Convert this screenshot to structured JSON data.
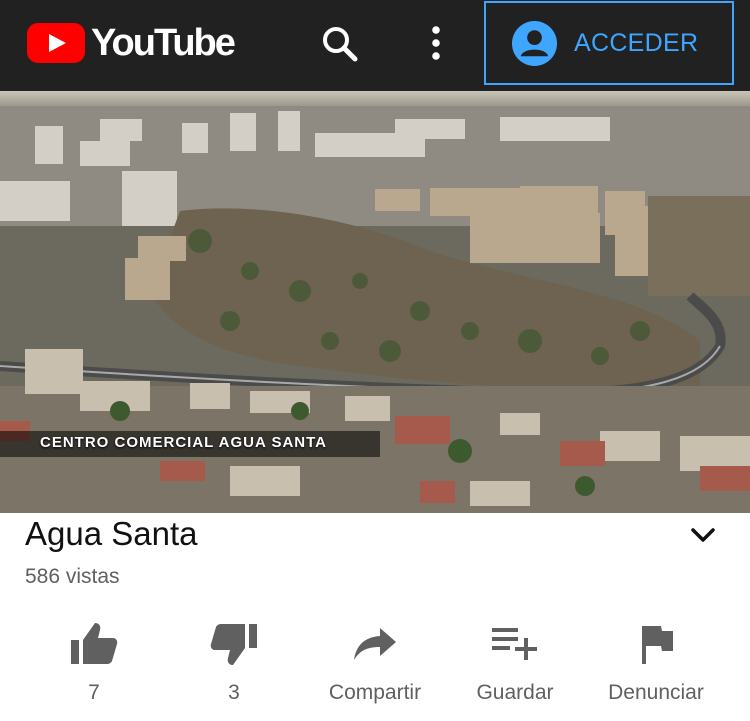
{
  "header": {
    "logo_text": "YouTube",
    "signin_label": "ACCEDER",
    "icons": [
      "search-icon",
      "more-vert-icon",
      "account-circle-icon"
    ],
    "colors": {
      "bar": "#212121",
      "brand": "#ff0000",
      "accent": "#3ea6ff"
    }
  },
  "video": {
    "overlay_caption": "CENTRO COMERCIAL AGUA SANTA"
  },
  "info": {
    "title": "Agua Santa",
    "views": "586 vistas"
  },
  "actions": [
    {
      "label": "7",
      "icon": "thumb-up-icon"
    },
    {
      "label": "3",
      "icon": "thumb-down-icon"
    },
    {
      "label": "Compartir",
      "icon": "share-icon"
    },
    {
      "label": "Guardar",
      "icon": "playlist-add-icon"
    },
    {
      "label": "Denunciar",
      "icon": "flag-icon"
    }
  ]
}
